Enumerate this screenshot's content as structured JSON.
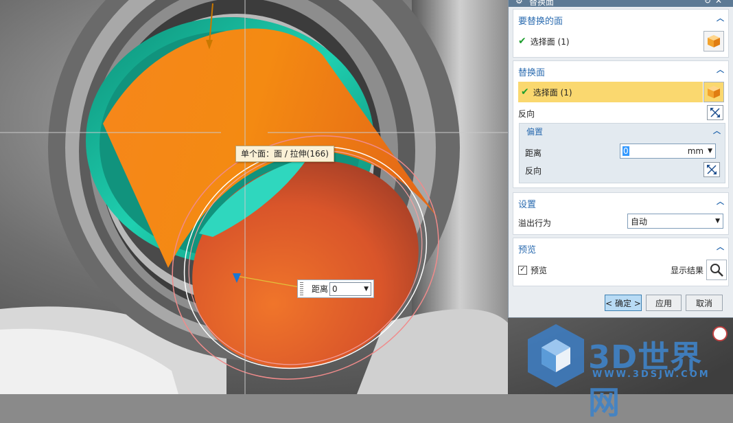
{
  "colors": {
    "accent": "#2c6cb0",
    "cylinder_orange": "#f07a1c",
    "teal_face": "#19c3a6",
    "highlight_row": "#fad86f",
    "titlebar": "#5d7a95"
  },
  "viewport": {
    "tooltip": "单个面：面 / 拉伸(166)",
    "distance_label": "距离",
    "distance_value": "0"
  },
  "dialog": {
    "title": "替换面",
    "face_to_replace": {
      "header": "要替换的面",
      "selection": "选择面 (1)",
      "icon": "cube-select-icon"
    },
    "replacement_face": {
      "header": "替换面",
      "selection": "选择面 (1)",
      "reverse_label": "反向",
      "icon": "cube-select-icon"
    },
    "offset": {
      "header": "偏置",
      "distance_label": "距离",
      "distance_value": "0",
      "unit": "mm",
      "reverse_label": "反向"
    },
    "settings": {
      "header": "设置",
      "overflow_label": "溢出行为",
      "overflow_value": "自动"
    },
    "preview": {
      "header": "预览",
      "preview_label": "预览",
      "show_result_label": "显示结果",
      "checked": true
    },
    "buttons": {
      "ok": "< 确定 >",
      "apply": "应用",
      "cancel": "取消"
    }
  },
  "watermark": {
    "brand": "3D世界网",
    "url": "WWW.3DSJW.COM"
  }
}
